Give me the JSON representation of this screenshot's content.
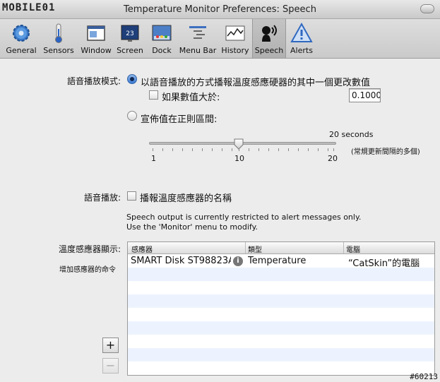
{
  "window": {
    "logo": "MOBILE01",
    "title": "Temperature Monitor Preferences: Speech"
  },
  "toolbar": {
    "items": [
      {
        "label": "General",
        "icon": "gear-icon"
      },
      {
        "label": "Sensors",
        "icon": "thermometer-icon"
      },
      {
        "label": "Window",
        "icon": "window-icon"
      },
      {
        "label": "Screen",
        "icon": "screen-icon"
      },
      {
        "label": "Dock",
        "icon": "dock-icon"
      },
      {
        "label": "Menu Bar",
        "icon": "menubar-icon"
      },
      {
        "label": "History",
        "icon": "history-icon"
      },
      {
        "label": "Speech",
        "icon": "speech-icon",
        "selected": true
      },
      {
        "label": "Alerts",
        "icon": "alert-icon"
      }
    ]
  },
  "speech_mode": {
    "label": "語音播放模式:",
    "option_change": "以語音播放的方式播報溫度感應硬器的其中一個更改數值",
    "if_value_greater": "如果數值大於:",
    "threshold_value": "0.1000",
    "option_interval": "宣佈值在正則區間:",
    "selected": "change"
  },
  "interval": {
    "current_label": "20 seconds",
    "tick_labels": [
      "1",
      "10",
      "20"
    ],
    "note": "(常規更新間隔的多個)",
    "value": 10,
    "min": 1,
    "max": 20
  },
  "speech_playback": {
    "label": "語音播放:",
    "checkbox_label": "播報溫度感應器的名稱",
    "checked": false,
    "info_line1": "Speech output is currently restricted to alert messages only.",
    "info_line2": "Use the 'Monitor' menu to modify."
  },
  "sensor_display": {
    "label": "溫度感應器顯示:",
    "add_label": "增加感應器的命令",
    "columns": [
      "感應器",
      "類型",
      "電腦"
    ],
    "rows": [
      {
        "sensor": "SMART Disk ST98823A",
        "type": "Temperature",
        "computer": "“CatSkin”的電腦"
      }
    ],
    "add_button": "+",
    "remove_button": "−"
  },
  "watermark": "#60213",
  "colors": {
    "accent": "#3b7bd3",
    "stripe": "#edf3fe"
  }
}
